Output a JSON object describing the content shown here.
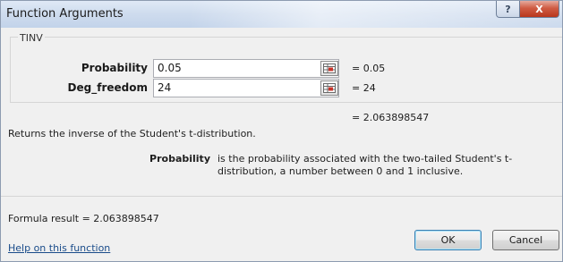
{
  "window": {
    "title": "Function Arguments",
    "help_button": "?",
    "close_button": "X"
  },
  "function_name": "TINV",
  "arguments": [
    {
      "label": "Probability",
      "value": "0.05",
      "evaluated": "= 0.05"
    },
    {
      "label": "Deg_freedom",
      "value": "24",
      "evaluated": "= 24"
    }
  ],
  "result_evaluated": "= 2.063898547",
  "description": "Returns the inverse of the Student's t-distribution.",
  "param_help": {
    "name": "Probability",
    "text": "is the probability associated with the two-tailed Student's t-distribution, a number between 0 and 1 inclusive."
  },
  "formula_result": "Formula result = 2.063898547",
  "help_link": "Help on this function",
  "buttons": {
    "ok": "OK",
    "cancel": "Cancel"
  },
  "colors": {
    "title_bar": "#cfdcee",
    "close_button": "#cf5c43",
    "link": "#1a4c8a"
  },
  "icons": {
    "collapse": "range-select-icon"
  }
}
